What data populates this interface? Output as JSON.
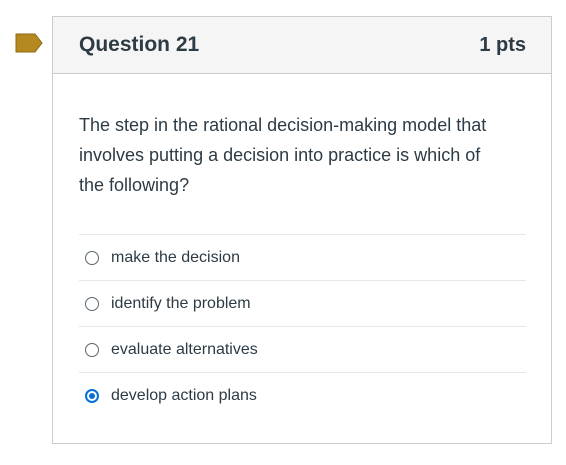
{
  "question": {
    "title": "Question 21",
    "points": "1 pts",
    "text": "The step in the rational decision-making model that involves putting a decision into practice is which of the following?",
    "flag_icon": "bookmark-flag-icon",
    "flag_color": "#b8860b"
  },
  "answers": [
    {
      "label": "make the decision",
      "selected": false
    },
    {
      "label": "identify the problem",
      "selected": false
    },
    {
      "label": "evaluate alternatives",
      "selected": false
    },
    {
      "label": "develop action plans",
      "selected": true
    }
  ],
  "colors": {
    "accent": "#0770d8",
    "header_bg": "#f5f5f5",
    "border": "#c7cdd1",
    "text": "#2d3b45"
  }
}
